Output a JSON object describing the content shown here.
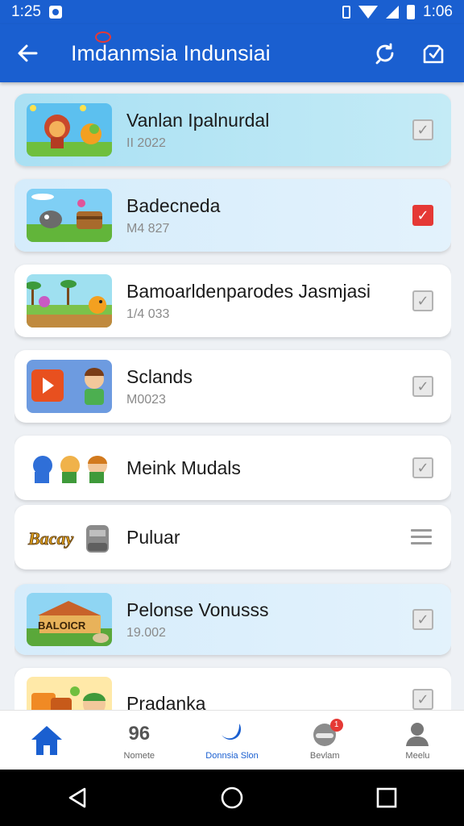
{
  "status_bar": {
    "time": "1:25",
    "right_time": "1:06"
  },
  "app_bar": {
    "title": "Imdanmsia Indunsiai"
  },
  "items": [
    {
      "title": "Vanlan Ipalnurdal",
      "subtitle": "ІІ 2022",
      "checked": false,
      "control": "checkbox"
    },
    {
      "title": "Badecneda",
      "subtitle": "M4 827",
      "checked": true,
      "control": "checkbox"
    },
    {
      "title": "Bamoarldenparodes Jasmjasi",
      "subtitle": "1/4 033",
      "checked": false,
      "control": "checkbox"
    },
    {
      "title": "Sclands",
      "subtitle": "M0023",
      "checked": false,
      "control": "checkbox"
    },
    {
      "title": "Meink Mudals",
      "subtitle": "",
      "checked": false,
      "control": "checkbox"
    },
    {
      "title": "Puluar",
      "subtitle": "",
      "checked": false,
      "control": "menu",
      "thumb_text": "Bacay"
    },
    {
      "title": "Pelonse Vonusss",
      "subtitle": "19.002",
      "checked": false,
      "control": "checkbox",
      "thumb_text": "BALOICR"
    },
    {
      "title": "Pradanka",
      "subtitle": "",
      "checked": false,
      "control": "checkbox"
    }
  ],
  "bottom_nav": [
    {
      "label": "",
      "icon": "home-icon",
      "active": true
    },
    {
      "label": "Nomete",
      "icon": "96-icon",
      "glyph": "96",
      "active": false
    },
    {
      "label": "Donnsia Slon",
      "icon": "moon-icon",
      "active": false
    },
    {
      "label": "Bevlam",
      "icon": "helmet-icon",
      "badge": "1",
      "active": false
    },
    {
      "label": "Meelu",
      "icon": "person-icon",
      "active": false
    }
  ],
  "colors": {
    "primary": "#1a5fd0",
    "check_red": "#e53935",
    "highlight_blue": "#a9e0f3"
  }
}
